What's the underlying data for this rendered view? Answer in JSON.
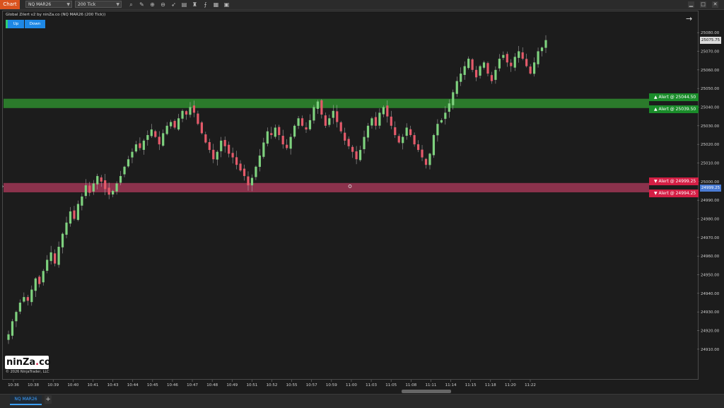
{
  "toolbar": {
    "chart_tab": "Chart",
    "instrument": "NQ MAR26",
    "interval": "200 Tick",
    "tools": [
      {
        "icon": "search-icon",
        "glyph": "⌕"
      },
      {
        "icon": "pencil-icon",
        "glyph": "✎"
      },
      {
        "icon": "zoom-in-icon",
        "glyph": "⊕"
      },
      {
        "icon": "zoom-out-icon",
        "glyph": "⊖"
      },
      {
        "icon": "pointer-icon",
        "glyph": "➶"
      },
      {
        "icon": "properties-icon",
        "glyph": "▤"
      },
      {
        "icon": "strategy-icon",
        "glyph": "♜"
      },
      {
        "icon": "indicators-icon",
        "glyph": "⨍"
      },
      {
        "icon": "datatable-icon",
        "glyph": "▦"
      },
      {
        "icon": "capture-icon",
        "glyph": "▣"
      }
    ],
    "window": {
      "minimize": "▁",
      "maximize": "□",
      "close": "✕"
    }
  },
  "indicator_title": "Global Zilert v2 by ninZa.co (NQ MAR26 (200 Tick))",
  "buttons": {
    "up": "Up",
    "down": "Down"
  },
  "alerts": [
    {
      "label": "▲ Alert @ 25044.50",
      "price": 25044.5,
      "color": "#1a8c2a"
    },
    {
      "label": "▲ Alert @ 25039.50",
      "price": 25039.5,
      "color": "#1a8c2a"
    },
    {
      "label": "▼ Alert @ 24999.25",
      "price": 24999.25,
      "color": "#d41f45"
    },
    {
      "label": "▼ Alert @ 24994.25",
      "price": 24994.25,
      "color": "#d41f45"
    }
  ],
  "zones": [
    {
      "type": "resistance",
      "top": 25044.5,
      "bottom": 25039.5,
      "color": "#2e8b2e"
    },
    {
      "type": "support",
      "top": 24999.25,
      "bottom": 24994.25,
      "color": "#b03a5c"
    }
  ],
  "price_tags": {
    "last_price": "25075.75",
    "crosshair_price": "24999.25"
  },
  "colors": {
    "up_candle": "#7ed17e",
    "down_candle": "#e45a6a"
  },
  "chart_data": {
    "type": "candlestick",
    "y_ticks": [
      25080,
      25070,
      25060,
      25050,
      25040,
      25030,
      25020,
      25010,
      25000,
      24990,
      24980,
      24970,
      24960,
      24950,
      24940,
      24930,
      24920,
      24910
    ],
    "y_tick_labels": [
      "25080.00",
      "25070.00",
      "25060.00",
      "25050.00",
      "25040.00",
      "25030.00",
      "25020.00",
      "25010.00",
      "25000.00",
      "24990.00",
      "24980.00",
      "24970.00",
      "24960.00",
      "24950.00",
      "24940.00",
      "24930.00",
      "24920.00",
      "24910.00"
    ],
    "ylim": [
      24905,
      25085
    ],
    "x_labels": [
      "10:36",
      "10:38",
      "10:39",
      "10:40",
      "10:41",
      "10:43",
      "10:44",
      "10:45",
      "10:46",
      "10:47",
      "10:48",
      "10:49",
      "10:51",
      "10:52",
      "10:55",
      "10:57",
      "10:59",
      "11:00",
      "11:03",
      "11:05",
      "11:08",
      "11:11",
      "11:14",
      "11:15",
      "11:18",
      "11:20",
      "11:22"
    ],
    "close_path": [
      24918,
      24925,
      24930,
      24935,
      24938,
      24936,
      24942,
      24948,
      24945,
      24952,
      24958,
      24962,
      24956,
      24965,
      24972,
      24978,
      24984,
      24980,
      24988,
      24992,
      24998,
      24994,
      24999,
      25003,
      25000,
      24996,
      24993,
      24995,
      24999,
      25003,
      25008,
      25012,
      25016,
      25020,
      25018,
      25022,
      25025,
      25028,
      25024,
      25020,
      25026,
      25030,
      25032,
      25029,
      25034,
      25038,
      25036,
      25040,
      25037,
      25031,
      25026,
      25021,
      25017,
      25012,
      25016,
      25022,
      25019,
      25015,
      25013,
      25009,
      25006,
      25003,
      24998,
      25002,
      25008,
      25014,
      25021,
      25027,
      25025,
      25029,
      25025,
      25020,
      25018,
      25024,
      25030,
      25034,
      25030,
      25028,
      25033,
      25040,
      25043,
      25036,
      25030,
      25034,
      25038,
      25032,
      25027,
      25022,
      25019,
      25016,
      25012,
      25017,
      25024,
      25030,
      25034,
      25030,
      25037,
      25040,
      25035,
      25030,
      25025,
      25021,
      25024,
      25029,
      25025,
      25020,
      25017,
      25013,
      25009,
      25015,
      25025,
      25031,
      25033,
      25037,
      25042,
      25048,
      25054,
      25058,
      25062,
      25066,
      25060,
      25056,
      25062,
      25064,
      25058,
      25054,
      25060,
      25066,
      25068,
      25064,
      25062,
      25067,
      25070,
      25066,
      25062,
      25058,
      25064,
      25070,
      25072,
      25076
    ]
  }
}
